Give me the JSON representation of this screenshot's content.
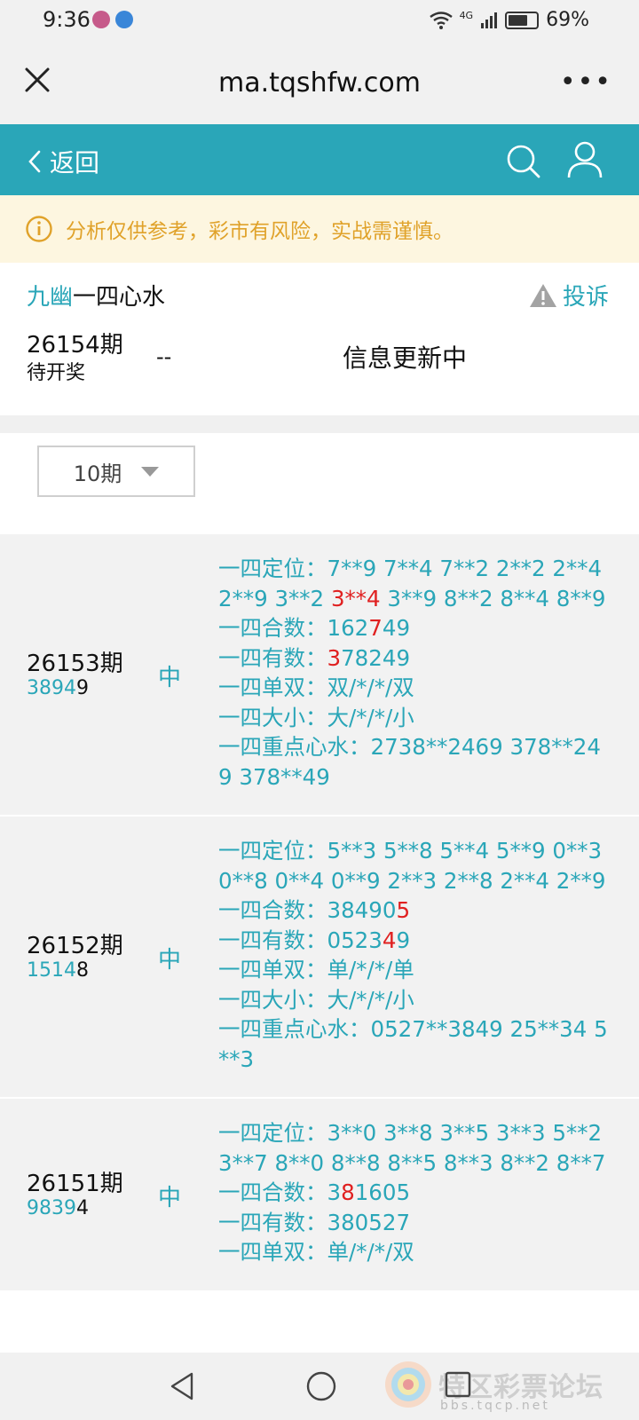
{
  "status": {
    "time": "9:36",
    "battery": "69%",
    "network": "4G",
    "battery_level": 0.69
  },
  "browser": {
    "url": "ma.tqshfw.com"
  },
  "header": {
    "back_label": "返回"
  },
  "notice": {
    "text": "分析仅供参考，彩市有风险，实战需谨慎。"
  },
  "info": {
    "title_prefix": "九幽",
    "title_rest": "一四心水",
    "report_label": "投诉",
    "current_issue": "26154期",
    "current_status": "待开奖",
    "dash": "--",
    "update_text": "信息更新中"
  },
  "selector": {
    "value": "10期"
  },
  "records": [
    {
      "issue": "26153期",
      "draw_lead": "3894",
      "draw_last": "9",
      "hit": "中",
      "lines": [
        [
          {
            "t": "一四定位：7**9 7**4 7**2 2**2 2**4 2**9 3**2 "
          },
          {
            "t": "3**4",
            "red": true
          },
          {
            "t": " 3**9 8**2 8**4 8**9"
          }
        ],
        [
          {
            "t": "一四合数：162"
          },
          {
            "t": "7",
            "red": true
          },
          {
            "t": "49"
          }
        ],
        [
          {
            "t": "一四有数："
          },
          {
            "t": "3",
            "red": true
          },
          {
            "t": "78249"
          }
        ],
        [
          {
            "t": "一四单双：双/*/*/双"
          }
        ],
        [
          {
            "t": "一四大小：大/*/*/小"
          }
        ],
        [
          {
            "t": "一四重点心水：2738**2469 378**249 378**49"
          }
        ]
      ]
    },
    {
      "issue": "26152期",
      "draw_lead": "1514",
      "draw_last": "8",
      "hit": "中",
      "lines": [
        [
          {
            "t": "一四定位：5**3 5**8 5**4 5**9 0**3 0**8 0**4 0**9 2**3 2**8 2**4 2**9"
          }
        ],
        [
          {
            "t": "一四合数：38490"
          },
          {
            "t": "5",
            "red": true
          }
        ],
        [
          {
            "t": "一四有数：0523"
          },
          {
            "t": "4",
            "red": true
          },
          {
            "t": "9"
          }
        ],
        [
          {
            "t": "一四单双：单/*/*/单"
          }
        ],
        [
          {
            "t": "一四大小：大/*/*/小"
          }
        ],
        [
          {
            "t": "一四重点心水：0527**3849 25**34 5**3"
          }
        ]
      ]
    },
    {
      "issue": "26151期",
      "draw_lead": "9839",
      "draw_last": "4",
      "hit": "中",
      "lines": [
        [
          {
            "t": "一四定位：3**0 3**8 3**5 3**3 5**2 3**7 8**0 8**8 8**5 8**3 8**2 8**7"
          }
        ],
        [
          {
            "t": "一四合数：3"
          },
          {
            "t": "8",
            "red": true
          },
          {
            "t": "1605"
          }
        ],
        [
          {
            "t": "一四有数：380527"
          }
        ],
        [
          {
            "t": "一四单双：单/*/*/双"
          }
        ]
      ]
    }
  ],
  "watermark": {
    "text": "特区彩票论坛",
    "sub": "bbs.tqcp.net"
  },
  "colors": {
    "accent": "#2aa6b8",
    "hit_red": "#e02020",
    "notice_text": "#e0a22a",
    "notice_bg": "#fdf6e0"
  }
}
